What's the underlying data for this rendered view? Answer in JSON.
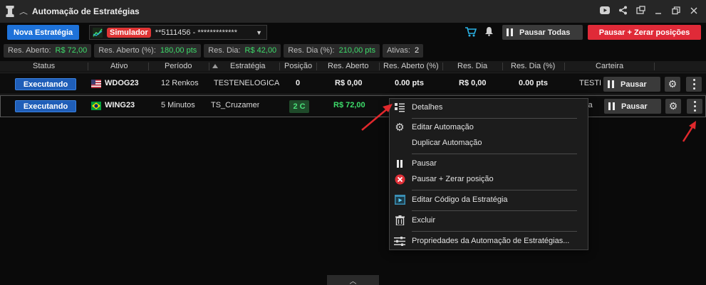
{
  "window": {
    "title": "Automação de Estratégias",
    "icons": [
      "youtube-icon",
      "share-icon",
      "detach-icon",
      "minimize-icon",
      "restore-icon",
      "close-icon"
    ]
  },
  "toolbar": {
    "new_strategy_label": "Nova Estratégia",
    "account_badge": "Simulador",
    "account_number": "**5111456 - *************",
    "pause_all_label": "Pausar Todas",
    "pause_zero_label": "Pausar + Zerar posições"
  },
  "stats": [
    {
      "label": "Res. Aberto:",
      "value": "R$ 72,00",
      "color": "green"
    },
    {
      "label": "Res. Aberto (%):",
      "value": "180,00 pts",
      "color": "green"
    },
    {
      "label": "Res. Dia:",
      "value": "R$ 42,00",
      "color": "green"
    },
    {
      "label": "Res. Dia (%):",
      "value": "210,00 pts",
      "color": "green"
    },
    {
      "label": "Ativas:",
      "value": "2",
      "color": "white"
    }
  ],
  "table": {
    "headers": [
      "Status",
      "Ativo",
      "Período",
      "Estratégia",
      "Posição",
      "Res. Aberto",
      "Res. Aberto (%)",
      "Res. Dia",
      "Res. Dia (%)",
      "Carteira"
    ],
    "rows": [
      {
        "status": "Executando",
        "flag": "us-flag-icon",
        "ativo": "WDOG23",
        "periodo": "12 Renkos",
        "estrategia": "TESTENELOGICA",
        "posicao": "0",
        "res_aberto": "R$ 0,00",
        "res_aberto_pct": "0.00 pts",
        "res_dia": "R$ 0,00",
        "res_dia_pct": "0.00 pts",
        "carteira": "TESTE",
        "pause_label": "Pausar"
      },
      {
        "status": "Executando",
        "flag": "brazil-flag-icon",
        "ativo": "WING23",
        "periodo": "5 Minutos",
        "estrategia": "TS_Cruzamento_Mé",
        "posicao": "2 C",
        "res_aberto": "R$ 72,00",
        "res_aberto_pct": "",
        "res_dia": "",
        "res_dia_pct": "",
        "carteira": "uza",
        "pause_label": "Pausar"
      }
    ]
  },
  "context_menu": {
    "items": [
      {
        "label": "Detalhes",
        "icon": "details-icon"
      },
      {
        "label": "Editar Automação",
        "icon": "gear-icon"
      },
      {
        "label": "Duplicar Automação",
        "icon": ""
      },
      {
        "label": "Pausar",
        "icon": "pause-icon"
      },
      {
        "label": "Pausar + Zerar posição",
        "icon": "red-x-icon"
      },
      {
        "label": "Editar Código da Estratégia",
        "icon": "code-editor-icon"
      },
      {
        "label": "Excluir",
        "icon": "trash-icon"
      },
      {
        "label": "Propriedades da Automação de Estratégias...",
        "icon": "properties-icon"
      }
    ]
  },
  "colors": {
    "accent_blue": "#1e72d9",
    "danger_red": "#e02a38",
    "profit_green": "#3ddc6a",
    "annotation_red": "#e0282c"
  }
}
